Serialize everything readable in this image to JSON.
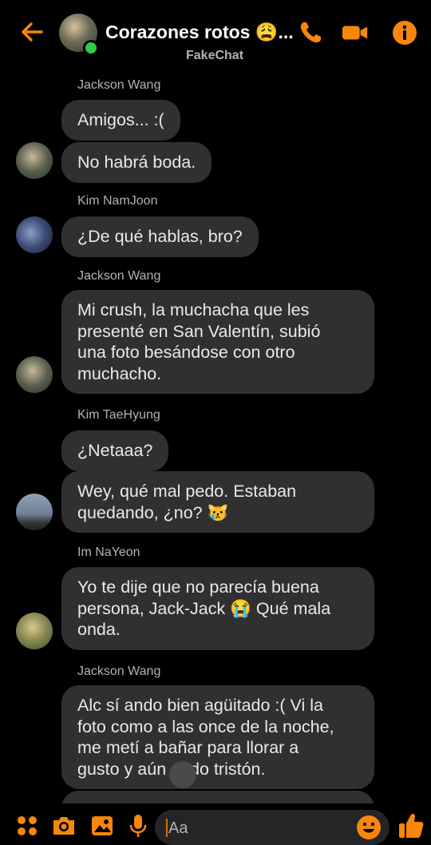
{
  "header": {
    "title": "Corazones rotos 😩...",
    "subtitle": "FakeChat",
    "accent_color": "#f7860a",
    "icons": [
      "back-arrow-icon",
      "phone-icon",
      "video-camera-icon",
      "info-icon"
    ]
  },
  "messages": [
    {
      "sender": "Jackson Wang",
      "bubbles": [
        "Amigos... :(",
        "No habrá boda."
      ]
    },
    {
      "sender": "Kim NamJoon",
      "bubbles": [
        "¿De qué hablas, bro?"
      ]
    },
    {
      "sender": "Jackson Wang",
      "bubbles": [
        "Mi crush, la muchacha que les\npresenté en San Valentín, subió\nuna foto besándose con otro\nmuchacho."
      ]
    },
    {
      "sender": "Kim TaeHyung",
      "bubbles": [
        "¿Netaaa?",
        "Wey, qué mal pedo. Estaban\nquedando, ¿no? 😿"
      ]
    },
    {
      "sender": "Im NaYeon",
      "bubbles": [
        "Yo te dije que no parecía buena\npersona, Jack-Jack 😭 Qué mala\nonda."
      ]
    },
    {
      "sender": "Jackson Wang",
      "bubbles": [
        "Alc sí ando bien agüitado :( Vi la\nfoto como a las once de la noche,\nme metí a bañar para llorar a\ngusto y aún     ando tristón."
      ]
    }
  ],
  "composer": {
    "placeholder": "Aa",
    "icons": [
      "apps-icon",
      "camera-icon",
      "gallery-icon",
      "microphone-icon",
      "emoji-icon",
      "thumbs-up-icon"
    ]
  }
}
